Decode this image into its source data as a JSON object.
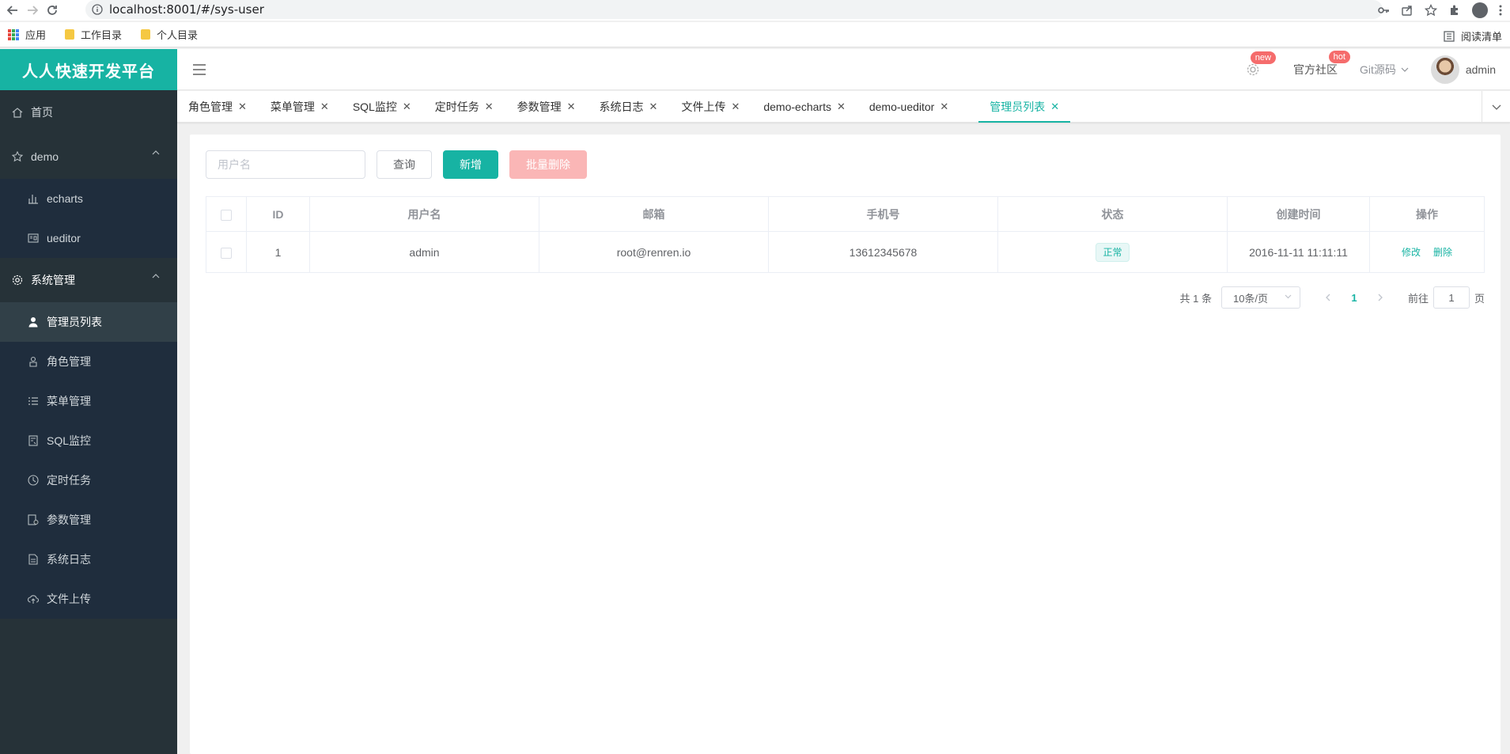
{
  "browser": {
    "url": "localhost:8001/#/sys-user",
    "bookmarks": [
      "应用",
      "工作目录",
      "个人目录"
    ],
    "reading_list": "阅读清单"
  },
  "app": {
    "brand": "人人快速开发平台"
  },
  "sidebar": {
    "items": [
      {
        "label": "首页",
        "icon": "home-icon"
      },
      {
        "label": "demo",
        "icon": "star-icon"
      },
      {
        "label": "echarts",
        "icon": "bar-chart-icon"
      },
      {
        "label": "ueditor",
        "icon": "editor-icon"
      },
      {
        "label": "系统管理",
        "icon": "gear-icon"
      },
      {
        "label": "管理员列表",
        "icon": "user-icon"
      },
      {
        "label": "角色管理",
        "icon": "role-icon"
      },
      {
        "label": "菜单管理",
        "icon": "menu-list-icon"
      },
      {
        "label": "SQL监控",
        "icon": "monitor-icon"
      },
      {
        "label": "定时任务",
        "icon": "clock-icon"
      },
      {
        "label": "参数管理",
        "icon": "params-icon"
      },
      {
        "label": "系统日志",
        "icon": "log-icon"
      },
      {
        "label": "文件上传",
        "icon": "upload-icon"
      }
    ]
  },
  "header": {
    "new_badge": "new",
    "community": "官方社区",
    "hot_badge": "hot",
    "git": "Git源码",
    "username": "admin"
  },
  "tabs": [
    {
      "label": "角色管理"
    },
    {
      "label": "菜单管理"
    },
    {
      "label": "SQL监控"
    },
    {
      "label": "定时任务"
    },
    {
      "label": "参数管理"
    },
    {
      "label": "系统日志"
    },
    {
      "label": "文件上传"
    },
    {
      "label": "demo-echarts"
    },
    {
      "label": "demo-ueditor"
    },
    {
      "label": "管理员列表"
    }
  ],
  "filters": {
    "username_placeholder": "用户名",
    "query": "查询",
    "add": "新增",
    "batch_delete": "批量删除"
  },
  "table": {
    "columns": [
      "ID",
      "用户名",
      "邮箱",
      "手机号",
      "状态",
      "创建时间",
      "操作"
    ],
    "rows": [
      {
        "id": "1",
        "username": "admin",
        "email": "root@renren.io",
        "mobile": "13612345678",
        "status": "正常",
        "created": "2016-11-11 11:11:11",
        "edit": "修改",
        "delete": "删除"
      }
    ]
  },
  "pagination": {
    "total": "共 1 条",
    "page_size": "10条/页",
    "current": "1",
    "goto_prefix": "前往",
    "goto_value": "1",
    "goto_suffix": "页"
  },
  "colors": {
    "accent": "#17b3a3",
    "sidebar_bg": "#263238",
    "danger_light": "#fab6b6"
  }
}
